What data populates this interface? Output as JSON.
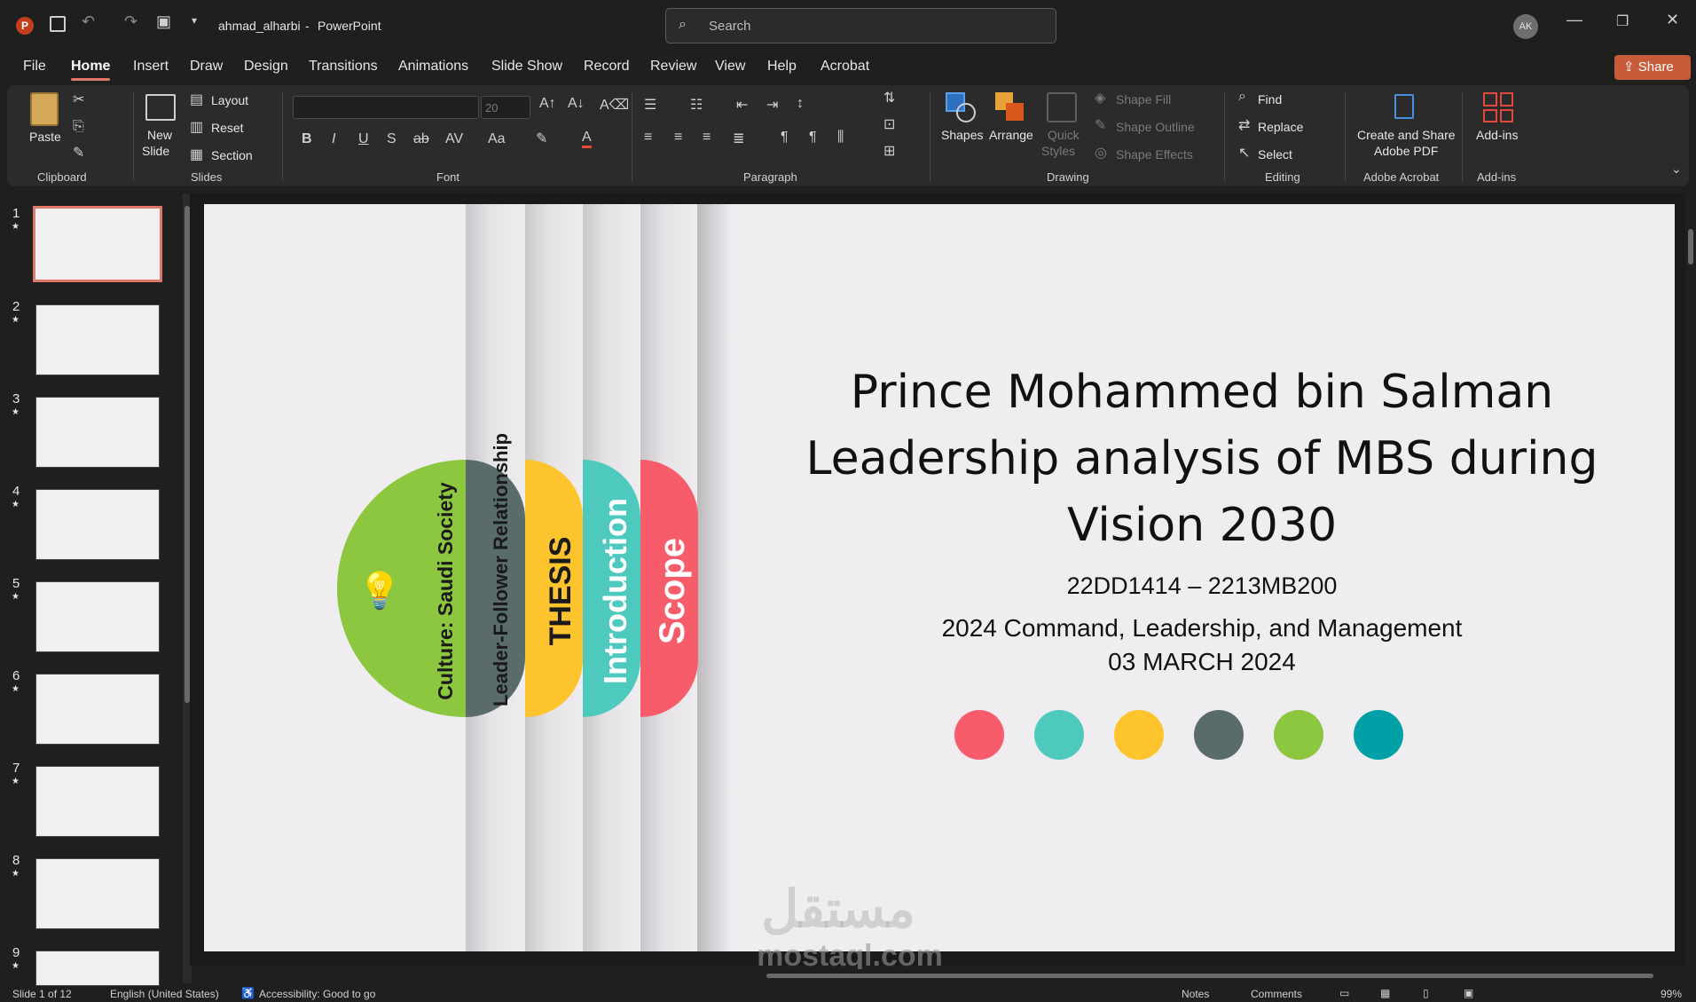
{
  "app": {
    "doc_name": "ahmad_alharbi",
    "separator": "-",
    "app_name": "PowerPoint",
    "search_placeholder": "Search",
    "avatar": "AK",
    "share": "Share"
  },
  "menu": [
    "File",
    "Home",
    "Insert",
    "Draw",
    "Design",
    "Transitions",
    "Animations",
    "Slide Show",
    "Record",
    "Review",
    "View",
    "Help",
    "Acrobat"
  ],
  "ribbon": {
    "clipboard": {
      "paste": "Paste",
      "label": "Clipboard"
    },
    "slides": {
      "new_slide_1": "New",
      "new_slide_2": "Slide",
      "layout": "Layout",
      "reset": "Reset",
      "section": "Section",
      "label": "Slides"
    },
    "font": {
      "size": "20",
      "label": "Font"
    },
    "paragraph": {
      "label": "Paragraph"
    },
    "drawing": {
      "shapes": "Shapes",
      "arrange": "Arrange",
      "quick_styles_1": "Quick",
      "quick_styles_2": "Styles",
      "shape_fill": "Shape Fill",
      "shape_outline": "Shape Outline",
      "shape_effects": "Shape Effects",
      "label": "Drawing"
    },
    "editing": {
      "find": "Find",
      "replace": "Replace",
      "select": "Select",
      "label": "Editing"
    },
    "acrobat": {
      "line1": "Create and Share",
      "line2": "Adobe PDF",
      "label": "Adobe Acrobat"
    },
    "addins": {
      "btn": "Add-ins",
      "label": "Add-ins"
    }
  },
  "thumbnails": [
    "1",
    "2",
    "3",
    "4",
    "5",
    "6",
    "7",
    "8",
    "9"
  ],
  "slide": {
    "title_line1": "Prince Mohammed bin Salman",
    "title_line2": "Leadership analysis of MBS during",
    "title_line3": "Vision 2030",
    "code": "22DD1414 – 2213MB200",
    "course": "2024 Command, Leadership, and Management",
    "date": "03 MARCH 2024",
    "tabs": [
      {
        "label": "Culture: Saudi Society",
        "color": "#8dc63f"
      },
      {
        "label": "Leader-Follower Relationship",
        "color": "#5a6b6b"
      },
      {
        "label": "THESIS",
        "color": "#fec42d"
      },
      {
        "label": "Introduction",
        "color": "#4ec9bd"
      },
      {
        "label": "Scope",
        "color": "#f75c6b"
      }
    ],
    "dots": [
      "#f75c6b",
      "#4ec9bd",
      "#fec42d",
      "#5a6b6b",
      "#8dc63f",
      "#00a0a8"
    ],
    "watermark_ar": "مستقل",
    "watermark_en": "mostaql.com"
  },
  "status": {
    "slide_of": "Slide 1 of 12",
    "language": "English (United States)",
    "accessibility": "Accessibility: Good to go",
    "notes": "Notes",
    "comments": "Comments",
    "zoom": "99%"
  },
  "colors": {
    "accent": "#e0776b",
    "share_bg": "#c75b3a"
  }
}
